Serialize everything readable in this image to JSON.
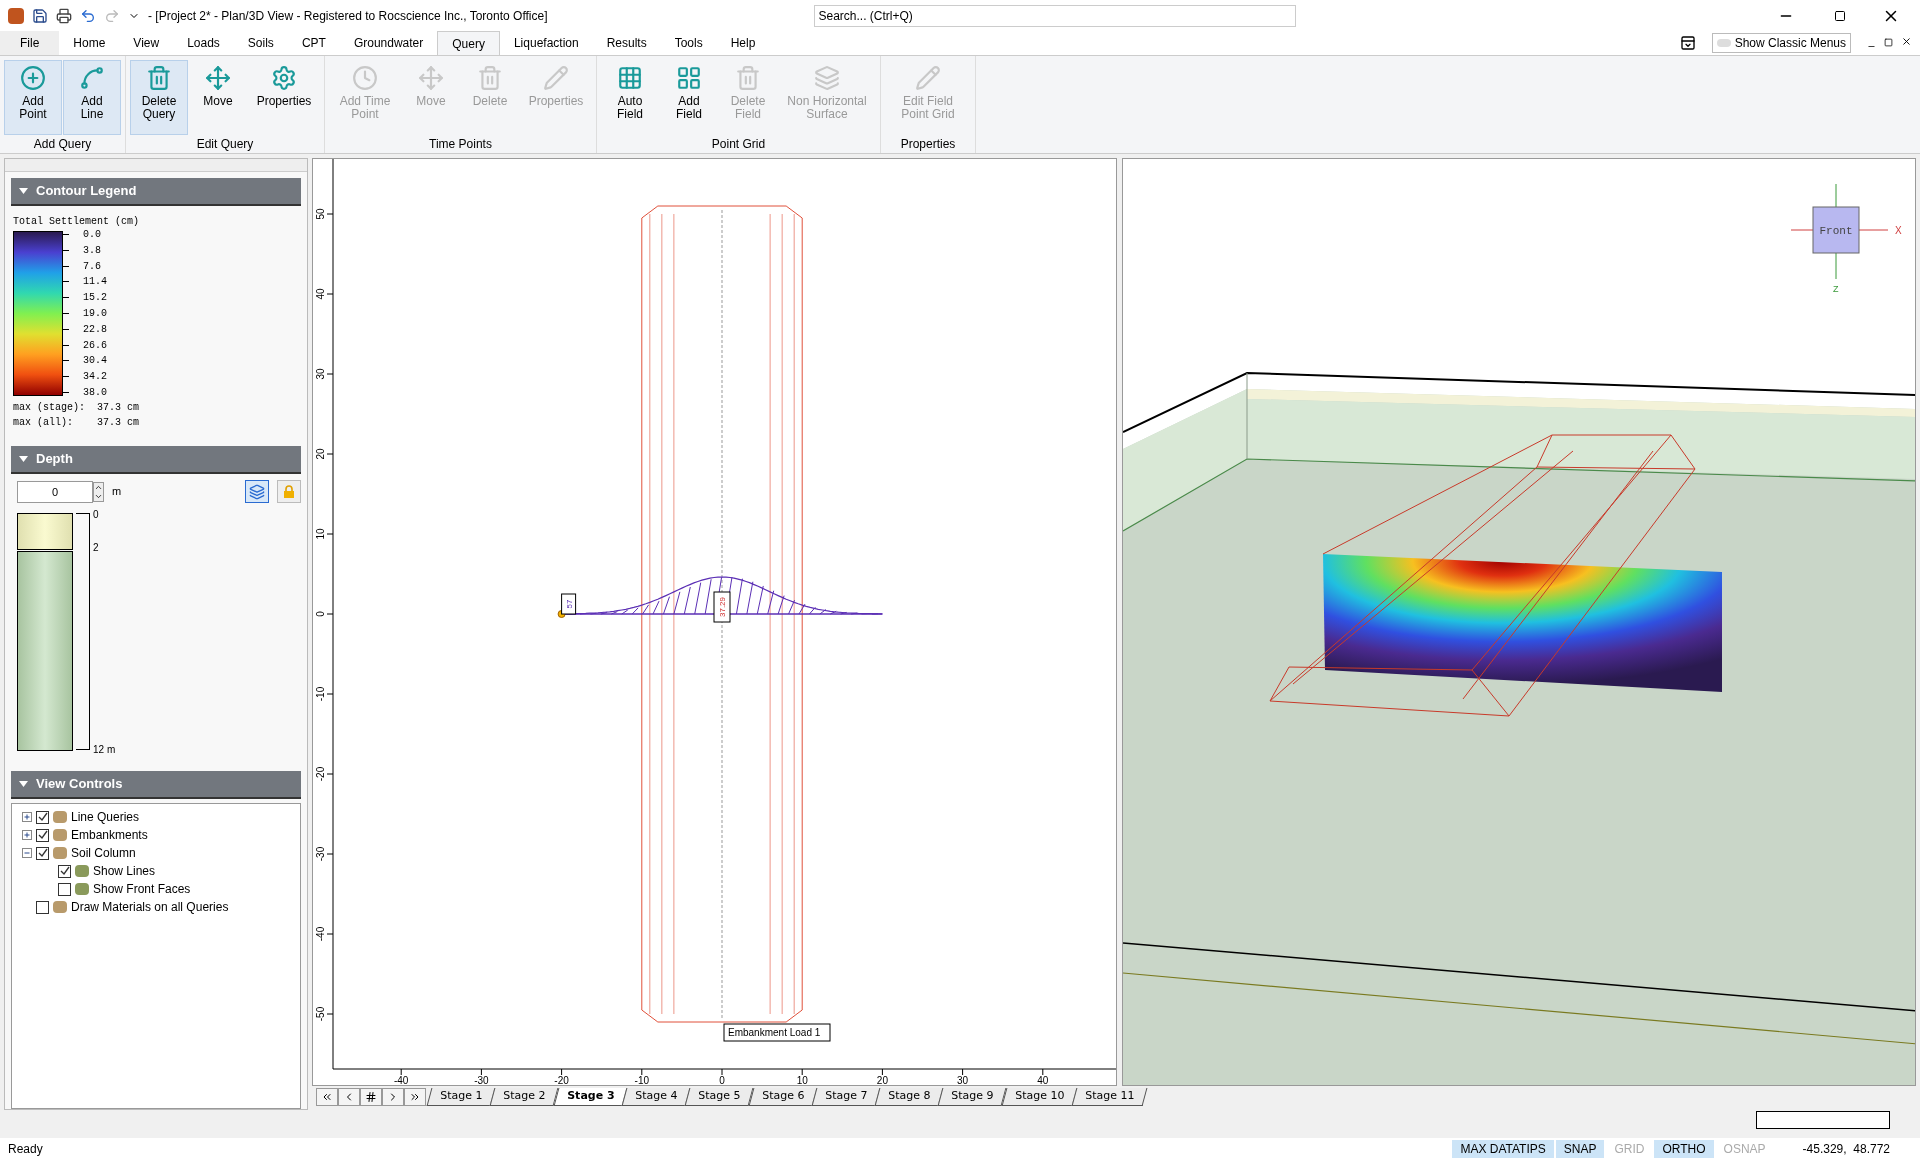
{
  "window": {
    "title": "- [Project 2* - Plan/3D View - Registered to Rocscience Inc., Toronto Office]",
    "search": {
      "placeholder": "Search... (Ctrl+Q)"
    }
  },
  "menu_tabs": [
    {
      "label": "File",
      "selected": false
    },
    {
      "label": "Home",
      "selected": false
    },
    {
      "label": "View",
      "selected": false
    },
    {
      "label": "Loads",
      "selected": false
    },
    {
      "label": "Soils",
      "selected": false
    },
    {
      "label": "CPT",
      "selected": false
    },
    {
      "label": "Groundwater",
      "selected": false
    },
    {
      "label": "Query",
      "selected": true
    },
    {
      "label": "Liquefaction",
      "selected": false
    },
    {
      "label": "Results",
      "selected": false
    },
    {
      "label": "Tools",
      "selected": false
    },
    {
      "label": "Help",
      "selected": false
    }
  ],
  "classic_menus": {
    "label": "Show Classic Menus",
    "on": false
  },
  "ribbon": [
    {
      "label": "Add Query",
      "buttons": [
        {
          "label": "Add Point",
          "disabled": false,
          "selected": true
        },
        {
          "label": "Add Line",
          "disabled": false,
          "selected": true
        }
      ]
    },
    {
      "label": "Edit Query",
      "buttons": [
        {
          "label": "Delete Query",
          "disabled": false,
          "selected": true
        },
        {
          "label": "Move",
          "disabled": false,
          "selected": false
        },
        {
          "label": "Properties",
          "disabled": false,
          "selected": false
        }
      ]
    },
    {
      "label": "Time Points",
      "buttons": [
        {
          "label": "Add Time Point",
          "disabled": true,
          "selected": false
        },
        {
          "label": "Move",
          "disabled": true,
          "selected": false
        },
        {
          "label": "Delete",
          "disabled": true,
          "selected": false
        },
        {
          "label": "Properties",
          "disabled": true,
          "selected": false
        }
      ]
    },
    {
      "label": "Point Grid",
      "buttons": [
        {
          "label": "Auto Field",
          "disabled": false,
          "selected": false
        },
        {
          "label": "Add Field",
          "disabled": false,
          "selected": false
        },
        {
          "label": "Delete Field",
          "disabled": true,
          "selected": false
        },
        {
          "label": "Non Horizontal Surface",
          "disabled": true,
          "selected": false
        }
      ]
    },
    {
      "label": "Properties",
      "buttons": [
        {
          "label": "Edit Field Point Grid",
          "disabled": true,
          "selected": false
        }
      ]
    }
  ],
  "contour_legend": {
    "title": "Contour Legend",
    "heading": "Total Settlement (cm)",
    "values": [
      "0.0",
      "3.8",
      "7.6",
      "11.4",
      "15.2",
      "19.0",
      "22.8",
      "26.6",
      "30.4",
      "34.2",
      "38.0"
    ],
    "max_stage": "max (stage):  37.3 cm",
    "max_all": "max (all):    37.3 cm"
  },
  "depth": {
    "title": "Depth",
    "value": "0",
    "unit": "m",
    "labels": [
      "0",
      "2",
      "12 m"
    ]
  },
  "view_controls": {
    "title": "View Controls",
    "items": [
      {
        "label": "Line Queries",
        "checked": true,
        "expanded": false
      },
      {
        "label": "Embankments",
        "checked": true,
        "expanded": false
      },
      {
        "label": "Soil Column",
        "checked": true,
        "expanded": true,
        "children": [
          {
            "label": "Show Lines",
            "checked": true
          },
          {
            "label": "Show Front Faces",
            "checked": false
          }
        ]
      },
      {
        "label": "Draw Materials on all Queries",
        "checked": false
      }
    ]
  },
  "plan_view": {
    "x_ticks": [
      "-40",
      "-30",
      "-20",
      "-10",
      "0",
      "10",
      "20",
      "30",
      "40"
    ],
    "y_ticks": [
      "50",
      "40",
      "30",
      "20",
      "10",
      "0",
      "-10",
      "-20",
      "-30",
      "-40",
      "-50"
    ],
    "left_label": "57",
    "peak_label": "37.29",
    "load_label": "Embankment Load 1"
  },
  "view_3d": {
    "cube_label": "Front",
    "axis_x": "X",
    "axis_z": "Z"
  },
  "stages": [
    {
      "label": "Stage 1",
      "selected": false
    },
    {
      "label": "Stage 2",
      "selected": false
    },
    {
      "label": "Stage 3",
      "selected": true
    },
    {
      "label": "Stage 4",
      "selected": false
    },
    {
      "label": "Stage 5",
      "selected": false
    },
    {
      "label": "Stage 6",
      "selected": false
    },
    {
      "label": "Stage 7",
      "selected": false
    },
    {
      "label": "Stage 8",
      "selected": false
    },
    {
      "label": "Stage 9",
      "selected": false
    },
    {
      "label": "Stage 10",
      "selected": false
    },
    {
      "label": "Stage 11",
      "selected": false
    }
  ],
  "status_bar": {
    "text": "Ready",
    "toggles": [
      {
        "label": "MAX DATATIPS",
        "on": true
      },
      {
        "label": "SNAP",
        "on": true
      },
      {
        "label": "GRID",
        "on": false
      },
      {
        "label": "ORTHO",
        "on": true
      },
      {
        "label": "OSNAP",
        "on": false
      }
    ],
    "coordinates": "-45.329,  48.772"
  }
}
